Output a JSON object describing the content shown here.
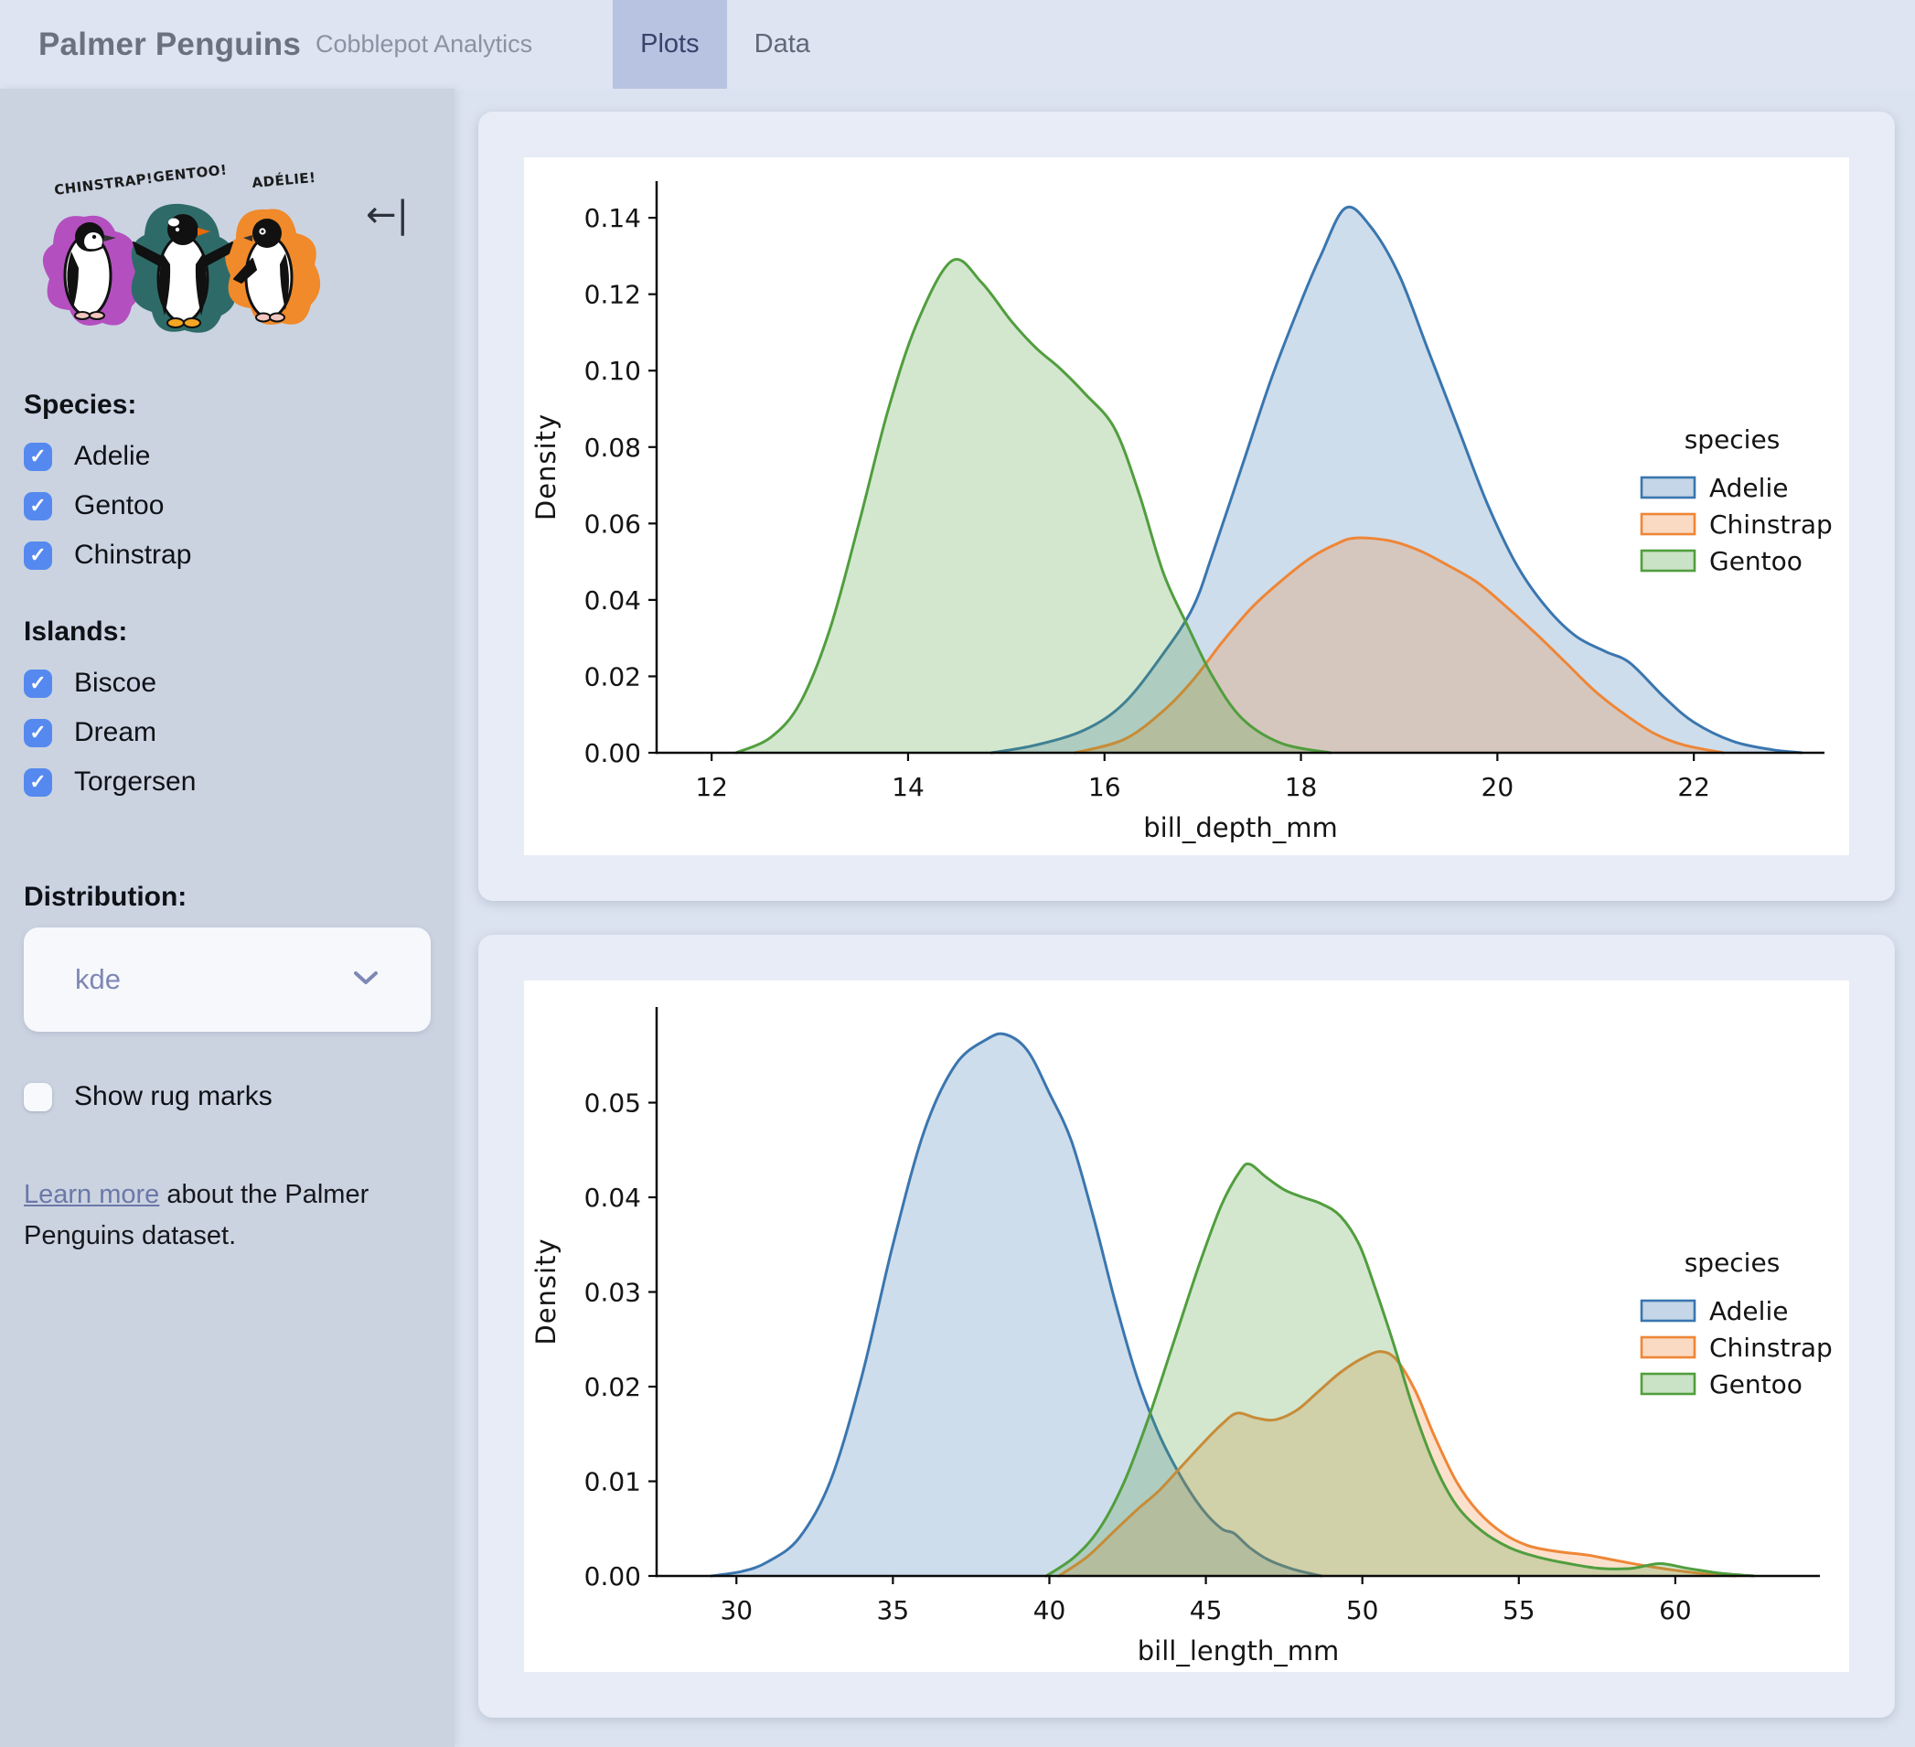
{
  "header": {
    "title": "Palmer Penguins",
    "subtitle": "Cobblepot Analytics",
    "tabs": [
      {
        "label": "Plots",
        "active": true
      },
      {
        "label": "Data",
        "active": false
      }
    ]
  },
  "icons": {
    "collapse": "←|",
    "chevron_down": "chevron-down",
    "checkmark": "✓"
  },
  "theme": {
    "checkbox_color": "#5589EF",
    "link_color": "#6C78A8",
    "select_text_color": "#7F88B4",
    "tab_active_bg": "#b7c3e0"
  },
  "sidebar": {
    "artwork": {
      "labels": [
        "CHINSTRAP!",
        "GENTOO!",
        "ADÉLIE!"
      ],
      "colors": [
        "#b44fc0",
        "#2e6b68",
        "#f08a2a"
      ]
    },
    "species": {
      "label": "Species:",
      "options": [
        {
          "label": "Adelie",
          "checked": true
        },
        {
          "label": "Gentoo",
          "checked": true
        },
        {
          "label": "Chinstrap",
          "checked": true
        }
      ]
    },
    "islands": {
      "label": "Islands:",
      "options": [
        {
          "label": "Biscoe",
          "checked": true
        },
        {
          "label": "Dream",
          "checked": true
        },
        {
          "label": "Torgersen",
          "checked": true
        }
      ]
    },
    "distribution": {
      "label": "Distribution:",
      "value": "kde"
    },
    "rug": {
      "label": "Show rug marks",
      "checked": false
    },
    "learn_more": {
      "link_text": "Learn more",
      "rest_text": " about the Palmer Penguins dataset."
    }
  },
  "chart_data": [
    {
      "type": "area",
      "kind": "kde",
      "xlabel": "bill_depth_mm",
      "ylabel": "Density",
      "xlim": [
        11.44,
        23.33
      ],
      "ylim": [
        0,
        0.1496
      ],
      "xticks": [
        12,
        14,
        16,
        18,
        20,
        22
      ],
      "xtick_labels": [
        "12",
        "14",
        "16",
        "18",
        "20",
        "22"
      ],
      "yticks": [
        0,
        0.02,
        0.04,
        0.06,
        0.08,
        0.1,
        0.12,
        0.14
      ],
      "ytick_labels": [
        "0.00",
        "0.02",
        "0.04",
        "0.06",
        "0.08",
        "0.10",
        "0.12",
        "0.14"
      ],
      "grid": false,
      "fill_alpha": 0.25,
      "legend": {
        "title": "species",
        "position": "right",
        "entries": [
          {
            "label": "Adelie",
            "color": "#3A76AF"
          },
          {
            "label": "Chinstrap",
            "color": "#EF8636"
          },
          {
            "label": "Gentoo",
            "color": "#519E3E"
          }
        ]
      },
      "series": [
        {
          "name": "Adelie",
          "color": "#3A76AF",
          "points": [
            [
              14.85,
              0
            ],
            [
              15.3,
              0.002
            ],
            [
              15.8,
              0.006
            ],
            [
              16.2,
              0.013
            ],
            [
              16.6,
              0.026
            ],
            [
              16.9,
              0.038
            ],
            [
              17.1,
              0.052
            ],
            [
              17.4,
              0.075
            ],
            [
              17.7,
              0.098
            ],
            [
              18.0,
              0.118
            ],
            [
              18.2,
              0.13
            ],
            [
              18.45,
              0.1425
            ],
            [
              18.7,
              0.138
            ],
            [
              19.0,
              0.125
            ],
            [
              19.3,
              0.105
            ],
            [
              19.6,
              0.085
            ],
            [
              19.9,
              0.065
            ],
            [
              20.2,
              0.049
            ],
            [
              20.5,
              0.038
            ],
            [
              20.8,
              0.0305
            ],
            [
              21.1,
              0.0265
            ],
            [
              21.35,
              0.0235
            ],
            [
              21.7,
              0.0145
            ],
            [
              22.0,
              0.008
            ],
            [
              22.4,
              0.003
            ],
            [
              22.8,
              0.0008
            ],
            [
              23.1,
              0
            ]
          ]
        },
        {
          "name": "Chinstrap",
          "color": "#EF8636",
          "points": [
            [
              15.7,
              0
            ],
            [
              16.2,
              0.0035
            ],
            [
              16.6,
              0.011
            ],
            [
              16.9,
              0.019
            ],
            [
              17.2,
              0.029
            ],
            [
              17.5,
              0.038
            ],
            [
              17.8,
              0.045
            ],
            [
              18.1,
              0.051
            ],
            [
              18.35,
              0.0545
            ],
            [
              18.55,
              0.0562
            ],
            [
              18.9,
              0.0555
            ],
            [
              19.2,
              0.053
            ],
            [
              19.5,
              0.049
            ],
            [
              19.8,
              0.0445
            ],
            [
              20.1,
              0.038
            ],
            [
              20.4,
              0.031
            ],
            [
              20.7,
              0.0235
            ],
            [
              21.0,
              0.016
            ],
            [
              21.3,
              0.01
            ],
            [
              21.6,
              0.005
            ],
            [
              21.9,
              0.002
            ],
            [
              22.3,
              0
            ]
          ]
        },
        {
          "name": "Gentoo",
          "color": "#519E3E",
          "points": [
            [
              12.25,
              0
            ],
            [
              12.6,
              0.004
            ],
            [
              12.9,
              0.013
            ],
            [
              13.2,
              0.032
            ],
            [
              13.5,
              0.06
            ],
            [
              13.8,
              0.09
            ],
            [
              14.1,
              0.113
            ],
            [
              14.45,
              0.1288
            ],
            [
              14.75,
              0.123
            ],
            [
              15.05,
              0.113
            ],
            [
              15.3,
              0.106
            ],
            [
              15.55,
              0.1005
            ],
            [
              15.8,
              0.094
            ],
            [
              16.1,
              0.085
            ],
            [
              16.35,
              0.068
            ],
            [
              16.6,
              0.047
            ],
            [
              16.85,
              0.033
            ],
            [
              17.1,
              0.02
            ],
            [
              17.4,
              0.009
            ],
            [
              17.8,
              0.0025
            ],
            [
              18.3,
              0
            ]
          ]
        }
      ]
    },
    {
      "type": "area",
      "kind": "kde",
      "xlabel": "bill_length_mm",
      "ylabel": "Density",
      "xlim": [
        27.45,
        64.62
      ],
      "ylim": [
        0,
        0.0601
      ],
      "xticks": [
        30,
        35,
        40,
        45,
        50,
        55,
        60
      ],
      "xtick_labels": [
        "30",
        "35",
        "40",
        "45",
        "50",
        "55",
        "60"
      ],
      "yticks": [
        0,
        0.01,
        0.02,
        0.03,
        0.04,
        0.05
      ],
      "ytick_labels": [
        "0.00",
        "0.01",
        "0.02",
        "0.03",
        "0.04",
        "0.05"
      ],
      "grid": false,
      "fill_alpha": 0.25,
      "legend": {
        "title": "species",
        "position": "right",
        "entries": [
          {
            "label": "Adelie",
            "color": "#3A76AF"
          },
          {
            "label": "Chinstrap",
            "color": "#EF8636"
          },
          {
            "label": "Gentoo",
            "color": "#519E3E"
          }
        ]
      },
      "series": [
        {
          "name": "Adelie",
          "color": "#3A76AF",
          "points": [
            [
              29.2,
              0
            ],
            [
              30.2,
              0.0005
            ],
            [
              31,
              0.0015
            ],
            [
              32,
              0.004
            ],
            [
              33,
              0.01
            ],
            [
              34,
              0.021
            ],
            [
              35,
              0.035
            ],
            [
              36,
              0.047
            ],
            [
              37,
              0.054
            ],
            [
              38,
              0.0567
            ],
            [
              38.6,
              0.0572
            ],
            [
              39.3,
              0.0555
            ],
            [
              40,
              0.051
            ],
            [
              40.7,
              0.046
            ],
            [
              41.4,
              0.038
            ],
            [
              42.1,
              0.029
            ],
            [
              42.8,
              0.021
            ],
            [
              43.5,
              0.015
            ],
            [
              44.2,
              0.0105
            ],
            [
              44.9,
              0.007
            ],
            [
              45.5,
              0.005
            ],
            [
              45.9,
              0.0045
            ],
            [
              46.4,
              0.003
            ],
            [
              47,
              0.0017
            ],
            [
              47.8,
              0.0007
            ],
            [
              48.7,
              0
            ]
          ]
        },
        {
          "name": "Chinstrap",
          "color": "#EF8636",
          "points": [
            [
              40.3,
              0
            ],
            [
              41.2,
              0.002
            ],
            [
              42,
              0.0045
            ],
            [
              42.8,
              0.007
            ],
            [
              43.5,
              0.009
            ],
            [
              44.2,
              0.0115
            ],
            [
              44.9,
              0.014
            ],
            [
              45.5,
              0.016
            ],
            [
              46,
              0.0172
            ],
            [
              46.6,
              0.0167
            ],
            [
              47.2,
              0.0165
            ],
            [
              47.9,
              0.0175
            ],
            [
              48.6,
              0.0195
            ],
            [
              49.3,
              0.0215
            ],
            [
              50,
              0.023
            ],
            [
              50.6,
              0.0237
            ],
            [
              51.1,
              0.0228
            ],
            [
              51.7,
              0.0195
            ],
            [
              52.3,
              0.0148
            ],
            [
              53,
              0.01
            ],
            [
              53.7,
              0.0068
            ],
            [
              54.5,
              0.0045
            ],
            [
              55.3,
              0.0032
            ],
            [
              56.2,
              0.0026
            ],
            [
              57.2,
              0.0022
            ],
            [
              58,
              0.0017
            ],
            [
              59,
              0.0011
            ],
            [
              60,
              0.0006
            ],
            [
              61,
              0.0002
            ],
            [
              61.9,
              0
            ]
          ]
        },
        {
          "name": "Gentoo",
          "color": "#519E3E",
          "points": [
            [
              39.9,
              0
            ],
            [
              40.8,
              0.002
            ],
            [
              41.6,
              0.005
            ],
            [
              42.4,
              0.01
            ],
            [
              43.2,
              0.017
            ],
            [
              44,
              0.025
            ],
            [
              44.8,
              0.033
            ],
            [
              45.5,
              0.0392
            ],
            [
              46.1,
              0.0428
            ],
            [
              46.4,
              0.0435
            ],
            [
              46.9,
              0.0422
            ],
            [
              47.5,
              0.0408
            ],
            [
              48.1,
              0.04
            ],
            [
              48.7,
              0.0393
            ],
            [
              49.3,
              0.038
            ],
            [
              49.9,
              0.035
            ],
            [
              50.4,
              0.0305
            ],
            [
              51,
              0.0245
            ],
            [
              51.6,
              0.018
            ],
            [
              52.3,
              0.0118
            ],
            [
              53,
              0.0075
            ],
            [
              53.8,
              0.0048
            ],
            [
              54.7,
              0.003
            ],
            [
              55.6,
              0.002
            ],
            [
              56.6,
              0.0013
            ],
            [
              57.6,
              0.0008
            ],
            [
              58.6,
              0.0008
            ],
            [
              59.5,
              0.0013
            ],
            [
              60.4,
              0.0008
            ],
            [
              61.4,
              0.0003
            ],
            [
              62.5,
              0
            ]
          ]
        }
      ]
    }
  ]
}
